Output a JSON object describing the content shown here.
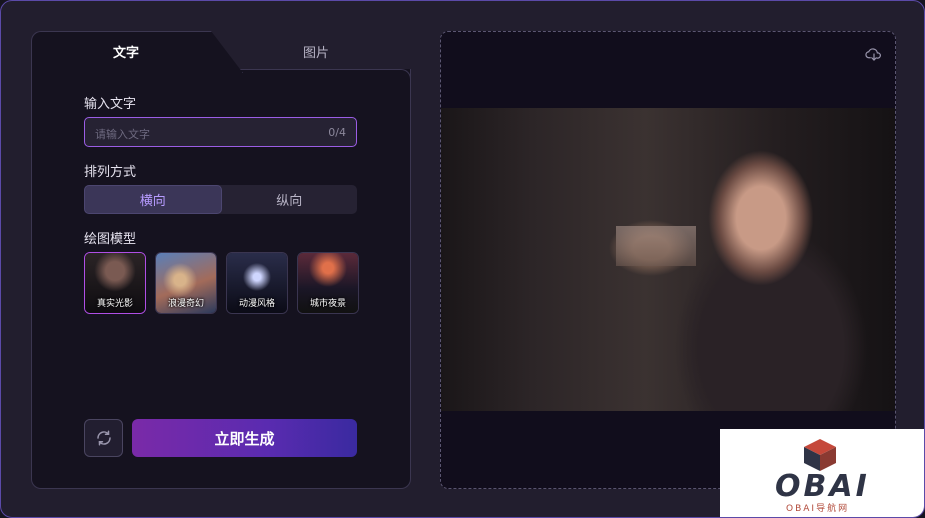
{
  "tabs": [
    {
      "label": "文字",
      "active": true
    },
    {
      "label": "图片",
      "active": false
    }
  ],
  "input": {
    "label": "输入文字",
    "placeholder": "请输入文字",
    "counter": "0/4"
  },
  "layout": {
    "label": "排列方式",
    "options": [
      "横向",
      "纵向"
    ],
    "selected": "横向"
  },
  "model": {
    "label": "绘图模型",
    "items": [
      {
        "name": "真实光影",
        "selected": true
      },
      {
        "name": "浪漫奇幻",
        "selected": false
      },
      {
        "name": "动漫风格",
        "selected": false
      },
      {
        "name": "城市夜景",
        "selected": false
      }
    ]
  },
  "actions": {
    "generate_label": "立即生成"
  },
  "watermark": {
    "brand": "OBAI",
    "sub": "OBAI导航网"
  },
  "colors": {
    "accent": "#9b5de5",
    "generate_start": "#7a2aa8",
    "generate_end": "#3a2aa0",
    "background": "#221e2e",
    "panel": "#15121f"
  },
  "icons": {
    "refresh": "refresh-icon",
    "download": "cloud-download-icon"
  }
}
